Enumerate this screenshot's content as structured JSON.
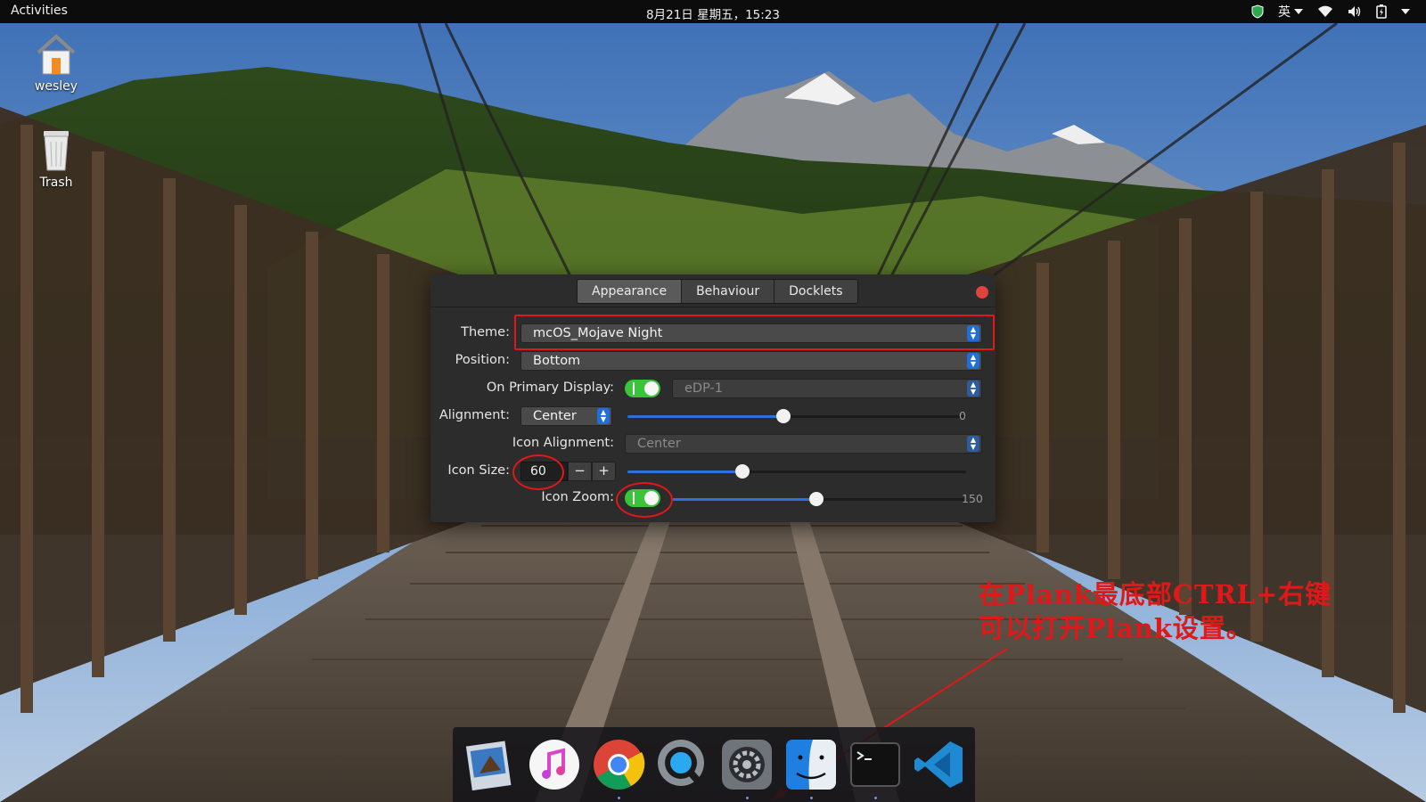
{
  "topbar": {
    "activities": "Activities",
    "clock": "8月21日 星期五，15:23",
    "lang": "英",
    "tray_icons": [
      "shield-icon",
      "wifi-icon",
      "volume-icon",
      "battery-icon"
    ]
  },
  "desktop": {
    "icons": [
      {
        "label": "wesley",
        "icon": "home-folder-icon"
      },
      {
        "label": "Trash",
        "icon": "trash-icon"
      }
    ]
  },
  "dialog": {
    "tabs": [
      {
        "label": "Appearance",
        "active": true
      },
      {
        "label": "Behaviour",
        "active": false
      },
      {
        "label": "Docklets",
        "active": false
      }
    ],
    "theme": {
      "label": "Theme:",
      "value": "mcOS_Mojave Night"
    },
    "position": {
      "label": "Position:",
      "value": "Bottom"
    },
    "primary_display": {
      "label": "On Primary Display:",
      "enabled": true,
      "display": "eDP-1"
    },
    "alignment": {
      "label": "Alignment:",
      "value": "Center",
      "offset_value": "0",
      "offset_level": 0.46
    },
    "icon_alignment": {
      "label": "Icon Alignment:",
      "value": "Center"
    },
    "icon_size": {
      "label": "Icon Size:",
      "value": "60",
      "minus": "−",
      "plus": "+",
      "level": 0.34
    },
    "icon_zoom": {
      "label": "Icon Zoom:",
      "enabled": true,
      "zoom_value": "150",
      "level": 0.49
    }
  },
  "annotation": {
    "line1": "在Plank最底部CTRL+右键",
    "line2": "可以打开Plank设置。",
    "color": "#e01818"
  },
  "dock": {
    "apps": [
      {
        "name": "mail-icon",
        "running": false
      },
      {
        "name": "music-icon",
        "running": false
      },
      {
        "name": "chrome-icon",
        "running": true
      },
      {
        "name": "quicktime-icon",
        "running": false
      },
      {
        "name": "system-preferences-icon",
        "running": true
      },
      {
        "name": "finder-icon",
        "running": true
      },
      {
        "name": "terminal-icon",
        "running": true
      },
      {
        "name": "vscode-icon",
        "running": false
      }
    ]
  }
}
